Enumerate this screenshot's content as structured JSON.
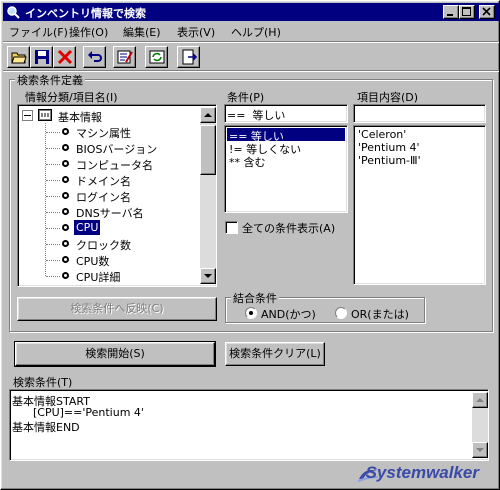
{
  "window": {
    "title": "インベントリ情報で検索"
  },
  "menu": [
    "ファイル(F)",
    "操作(O)",
    "編集(E)",
    "表示(V)",
    "ヘルプ(H)"
  ],
  "toolbar": [
    "open-folder-icon",
    "save-icon",
    "delete-icon",
    "undo-icon",
    "edit-condition-icon",
    "refresh-icon",
    "export-icon"
  ],
  "group_title": "検索条件定義",
  "tree": {
    "header": "情報分類/項目名(I)",
    "root": "基本情報",
    "items": [
      "マシン属性",
      "BIOSバージョン",
      "コンピュータ名",
      "ドメイン名",
      "ログイン名",
      "DNSサーバ名",
      "CPU",
      "クロック数",
      "CPU数",
      "CPU詳細"
    ],
    "selected": "CPU"
  },
  "condition": {
    "header": "条件(P)",
    "value": "==  等しい",
    "options": [
      "==  等しい",
      "!=  等しくない",
      "**  含む"
    ],
    "selected": "==  等しい"
  },
  "item_content": {
    "header": "項目内容(D)",
    "value": "",
    "options": [
      "'Celeron'",
      "'Pentium 4'",
      "'Pentium-Ⅲ'"
    ]
  },
  "show_all_conditions": {
    "label": "全ての条件表示(A)",
    "checked": false
  },
  "reflect_button": "検索条件へ反映(C)",
  "combine": {
    "title": "結合条件",
    "options": [
      "AND(かつ)",
      "OR(または)"
    ],
    "selected": "AND(かつ)"
  },
  "start_button": "検索開始(S)",
  "clear_button": "検索条件クリア(L)",
  "search_condition": {
    "label": "検索条件(T)",
    "lines": [
      "基本情報START",
      "      [CPU]=='Pentium 4'",
      "基本情報END"
    ]
  },
  "logo": "Systemwalker"
}
